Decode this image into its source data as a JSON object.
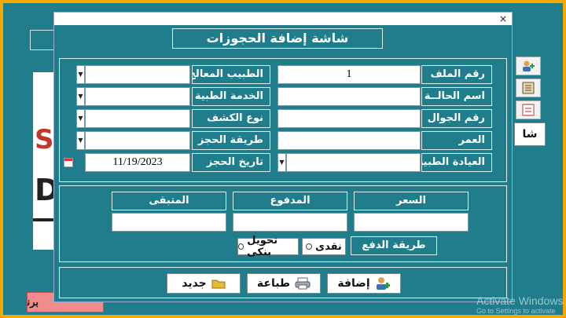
{
  "window": {
    "title": "شاشة إضافة الحجوزات",
    "close_glyph": "×"
  },
  "fields_right": [
    {
      "label": "رقم الملف",
      "value": "1"
    },
    {
      "label": "اسم الحالــة",
      "value": ""
    },
    {
      "label": "رقم الجوال",
      "value": ""
    },
    {
      "label": "العمر",
      "value": ""
    },
    {
      "label": "العيادة الطبية",
      "value": ""
    }
  ],
  "fields_left": [
    {
      "label": "الطبيب المعالج",
      "value": ""
    },
    {
      "label": "الخدمة الطبية",
      "value": ""
    },
    {
      "label": "نوع الكشف",
      "value": ""
    },
    {
      "label": "طريقة الحجز",
      "value": ""
    },
    {
      "label": "تاريخ الحجز",
      "value": "11/19/2023"
    }
  ],
  "payment": {
    "price_label": "السعر",
    "price_value": "",
    "paid_label": "المدفوع",
    "paid_value": "",
    "remaining_label": "المتبقى",
    "remaining_value": "",
    "method_label": "طريقة الدفع",
    "method_options": [
      "نقدى",
      "تحويل بنكى"
    ]
  },
  "buttons": {
    "add": "إضافة",
    "print": "طباعة",
    "new": "جديد"
  },
  "background": {
    "side_label": "شا",
    "red_button": "برنامج",
    "watermark_line1": "Activate Windows",
    "watermark_line2": "Go to Settings to activate"
  },
  "colors": {
    "frame": "#f5a800",
    "panel": "#1f7d8c",
    "border": "#dfeff1"
  },
  "icons": [
    "add-user-icon",
    "print-icon",
    "folder-icon",
    "calendar-icon",
    "dropdown-arrow-icon",
    "close-icon"
  ]
}
